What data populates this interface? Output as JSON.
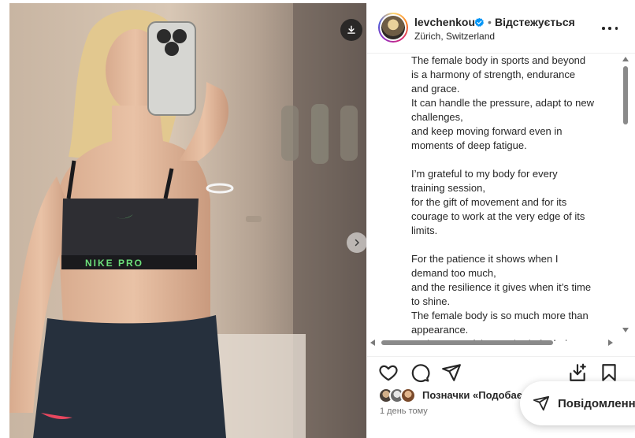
{
  "post": {
    "username": "levchenkou",
    "separator": "•",
    "follow_state": "Відстежується",
    "location": "Zürich, Switzerland",
    "caption": "The female body in sports and beyond\nis a harmony of strength, endurance\nand grace.\nIt can handle the pressure, adapt to new\nchallenges,\nand keep moving forward even in\nmoments of deep fatigue.\n\nI’m grateful to my body for every\ntraining session,\nfor the gift of movement and for its\ncourage to work at the very edge of its\nlimits.\n\nFor the patience it shows when I\ndemand too much,\nand the resilience it gives when it’s time\nto shine.\nThe female body is so much more than\nappearance.\nAnd I’m grateful to my body for being",
    "likes_text": "Позначки «Подобається»",
    "timestamp": "1 день тому"
  },
  "photo": {
    "top_band_text": "NIKE PRO"
  },
  "messages": {
    "label": "Повідомлення"
  },
  "icons": {
    "download": "download-icon",
    "next": "chevron-right-icon",
    "verified": "verified-badge-icon",
    "more": "more-horizontal-icon",
    "like": "heart-icon",
    "comment": "comment-icon",
    "share": "send-icon",
    "save": "bookmark-icon",
    "saved_collection": "save-to-collection-icon",
    "messages": "send-icon"
  },
  "colors": {
    "verified": "#0095f6",
    "text": "#262626",
    "muted": "#737373",
    "border": "#efefef"
  }
}
